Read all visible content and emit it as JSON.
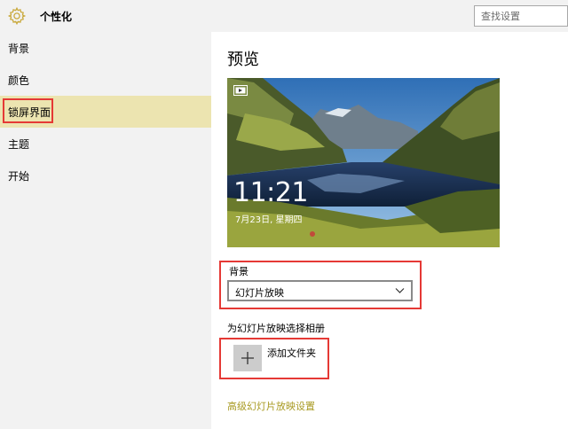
{
  "app": {
    "icon": "gear-icon",
    "title": "个性化"
  },
  "search": {
    "placeholder": "查找设置",
    "value": ""
  },
  "sidebar": {
    "items": [
      {
        "label": "背景",
        "active": false
      },
      {
        "label": "颜色",
        "active": false
      },
      {
        "label": "锁屏界面",
        "active": true
      },
      {
        "label": "主题",
        "active": false
      },
      {
        "label": "开始",
        "active": false
      }
    ]
  },
  "main": {
    "preview_heading": "预览",
    "lockscreen": {
      "icon": "slideshow-icon",
      "time": "11:21",
      "date": "7月23日, 星期四"
    },
    "background": {
      "label": "背景",
      "selected": "幻灯片放映"
    },
    "album": {
      "label": "为幻灯片放映选择相册",
      "add_icon": "plus-icon",
      "add_label": "添加文件夹"
    },
    "advanced_link": "高级幻灯片放映设置"
  },
  "colors": {
    "accent": "#a89a22",
    "active_nav": "#ece4b0",
    "highlight_box": "#e53935",
    "sidebar_bg": "#f2f2f2"
  }
}
